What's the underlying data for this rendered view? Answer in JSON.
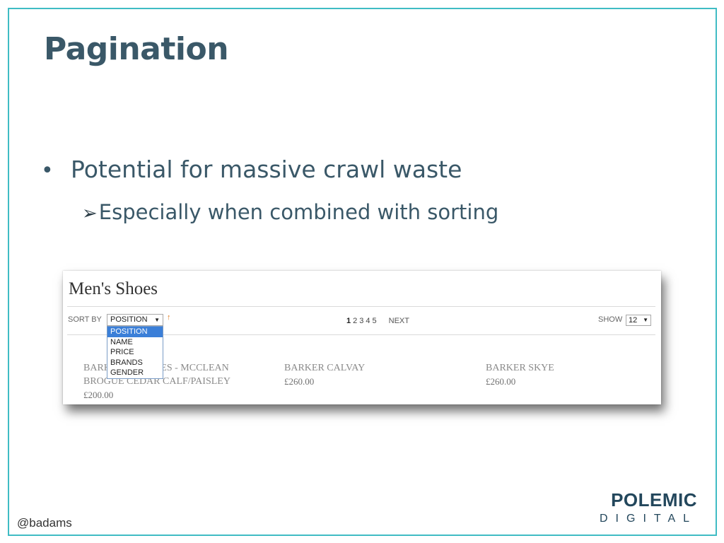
{
  "slide": {
    "title": "Pagination",
    "bullet": "Potential for massive crawl waste",
    "sub_bullet": "Especially when combined with sorting",
    "handle": "@badams",
    "logo_top": "POLEMIC",
    "logo_bottom": "DIGITAL"
  },
  "shop": {
    "title": "Men's Shoes",
    "sort_label": "SORT BY",
    "sort_selected": "POSITION",
    "sort_options": [
      "POSITION",
      "NAME",
      "PRICE",
      "BRANDS",
      "GENDER"
    ],
    "pages": [
      "1",
      "2",
      "3",
      "4",
      "5"
    ],
    "next_label": "NEXT",
    "show_label": "SHOW",
    "show_value": "12",
    "products": [
      {
        "name_line1": "BARKER BROGUES - MCCLEAN",
        "name_line2": "BROGUE CEDAR CALF/PAISLEY",
        "price": "£200.00"
      },
      {
        "name_line1": "BARKER CALVAY",
        "name_line2": "",
        "price": "£260.00"
      },
      {
        "name_line1": "BARKER SKYE",
        "name_line2": "",
        "price": "£260.00"
      }
    ]
  },
  "colors": {
    "frame": "#3fbcc4",
    "text": "#3a5868",
    "logo": "#23475c",
    "dropdown_highlight": "#3b7fd8"
  }
}
